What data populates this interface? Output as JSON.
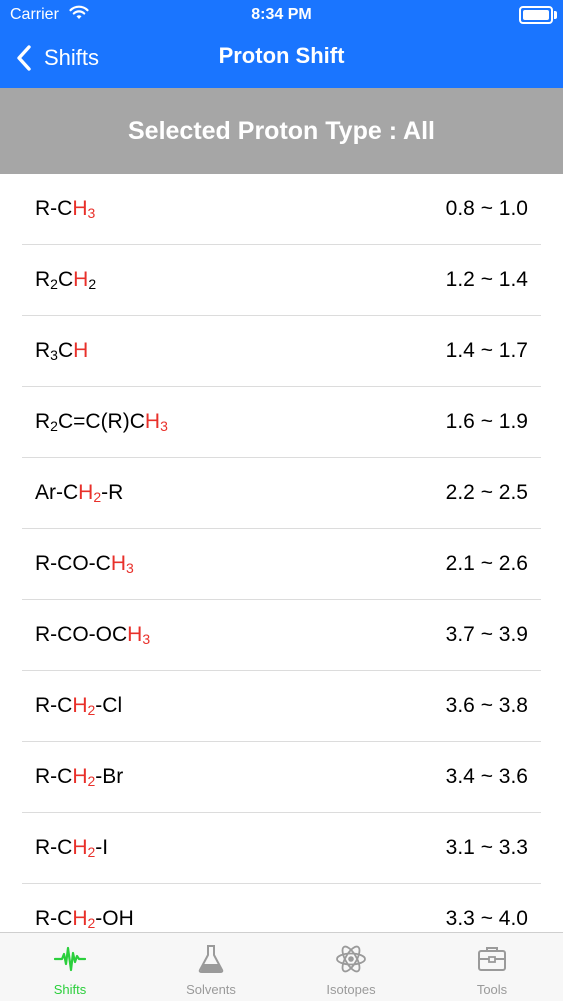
{
  "status_bar": {
    "carrier": "Carrier",
    "time": "8:34 PM"
  },
  "nav": {
    "back_label": "Shifts",
    "title": "Proton Shift"
  },
  "banner": {
    "text": "Selected Proton Type : All"
  },
  "colors": {
    "header": "#1a75ff",
    "banner": "#a6a6a6",
    "highlight": "#e8302a",
    "active_tab": "#2bcf3c"
  },
  "rows": [
    {
      "f": [
        [
          "R-C",
          0
        ],
        [
          "H",
          1
        ],
        [
          "3",
          2
        ]
      ],
      "range": "0.8 ~ 1.0"
    },
    {
      "f": [
        [
          "R",
          0
        ],
        [
          "2",
          3
        ],
        [
          "C",
          0
        ],
        [
          "H",
          1
        ],
        [
          "2",
          3
        ]
      ],
      "range": "1.2 ~ 1.4"
    },
    {
      "f": [
        [
          "R",
          0
        ],
        [
          "3",
          3
        ],
        [
          "C",
          0
        ],
        [
          "H",
          1
        ]
      ],
      "range": "1.4 ~ 1.7"
    },
    {
      "f": [
        [
          "R",
          0
        ],
        [
          "2",
          3
        ],
        [
          "C=C(R)C",
          0
        ],
        [
          "H",
          1
        ],
        [
          "3",
          2
        ]
      ],
      "range": "1.6 ~ 1.9"
    },
    {
      "f": [
        [
          "Ar-C",
          0
        ],
        [
          "H",
          1
        ],
        [
          "2",
          2
        ],
        [
          "-R",
          0
        ]
      ],
      "range": "2.2 ~ 2.5"
    },
    {
      "f": [
        [
          "R-CO-C",
          0
        ],
        [
          "H",
          1
        ],
        [
          "3",
          2
        ]
      ],
      "range": "2.1 ~ 2.6"
    },
    {
      "f": [
        [
          "R-CO-OC",
          0
        ],
        [
          "H",
          1
        ],
        [
          "3",
          2
        ]
      ],
      "range": "3.7 ~ 3.9"
    },
    {
      "f": [
        [
          "R-C",
          0
        ],
        [
          "H",
          1
        ],
        [
          "2",
          2
        ],
        [
          "-Cl",
          0
        ]
      ],
      "range": "3.6 ~ 3.8"
    },
    {
      "f": [
        [
          "R-C",
          0
        ],
        [
          "H",
          1
        ],
        [
          "2",
          2
        ],
        [
          "-Br",
          0
        ]
      ],
      "range": "3.4 ~ 3.6"
    },
    {
      "f": [
        [
          "R-C",
          0
        ],
        [
          "H",
          1
        ],
        [
          "2",
          2
        ],
        [
          "-I",
          0
        ]
      ],
      "range": "3.1 ~ 3.3"
    },
    {
      "f": [
        [
          "R-C",
          0
        ],
        [
          "H",
          1
        ],
        [
          "2",
          2
        ],
        [
          "-OH",
          0
        ]
      ],
      "range": "3.3 ~ 4.0"
    }
  ],
  "tabs": [
    {
      "label": "Shifts",
      "icon": "waveform-icon",
      "active": true
    },
    {
      "label": "Solvents",
      "icon": "flask-icon",
      "active": false
    },
    {
      "label": "Isotopes",
      "icon": "atom-icon",
      "active": false
    },
    {
      "label": "Tools",
      "icon": "toolbox-icon",
      "active": false
    }
  ]
}
